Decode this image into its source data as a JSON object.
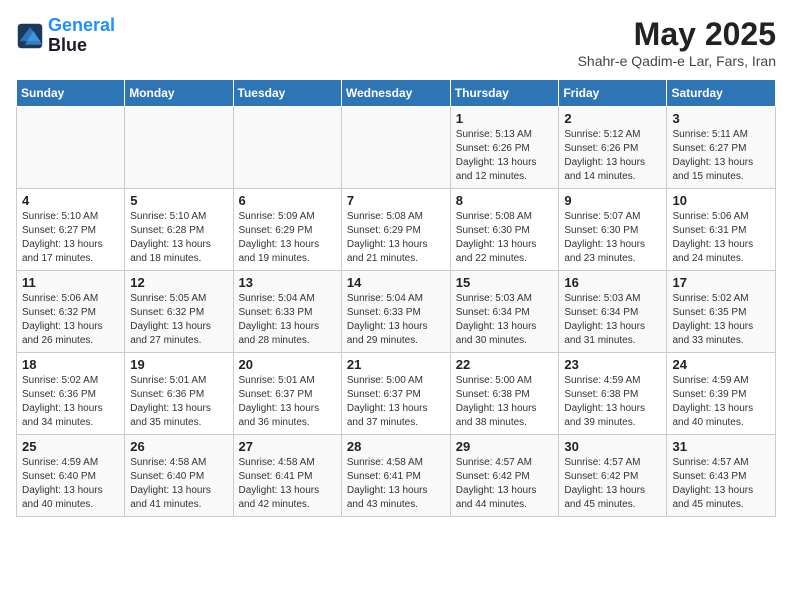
{
  "logo": {
    "line1": "General",
    "line2": "Blue"
  },
  "title": "May 2025",
  "location": "Shahr-e Qadim-e Lar, Fars, Iran",
  "weekdays": [
    "Sunday",
    "Monday",
    "Tuesday",
    "Wednesday",
    "Thursday",
    "Friday",
    "Saturday"
  ],
  "weeks": [
    [
      {
        "day": "",
        "info": ""
      },
      {
        "day": "",
        "info": ""
      },
      {
        "day": "",
        "info": ""
      },
      {
        "day": "",
        "info": ""
      },
      {
        "day": "1",
        "info": "Sunrise: 5:13 AM\nSunset: 6:26 PM\nDaylight: 13 hours\nand 12 minutes."
      },
      {
        "day": "2",
        "info": "Sunrise: 5:12 AM\nSunset: 6:26 PM\nDaylight: 13 hours\nand 14 minutes."
      },
      {
        "day": "3",
        "info": "Sunrise: 5:11 AM\nSunset: 6:27 PM\nDaylight: 13 hours\nand 15 minutes."
      }
    ],
    [
      {
        "day": "4",
        "info": "Sunrise: 5:10 AM\nSunset: 6:27 PM\nDaylight: 13 hours\nand 17 minutes."
      },
      {
        "day": "5",
        "info": "Sunrise: 5:10 AM\nSunset: 6:28 PM\nDaylight: 13 hours\nand 18 minutes."
      },
      {
        "day": "6",
        "info": "Sunrise: 5:09 AM\nSunset: 6:29 PM\nDaylight: 13 hours\nand 19 minutes."
      },
      {
        "day": "7",
        "info": "Sunrise: 5:08 AM\nSunset: 6:29 PM\nDaylight: 13 hours\nand 21 minutes."
      },
      {
        "day": "8",
        "info": "Sunrise: 5:08 AM\nSunset: 6:30 PM\nDaylight: 13 hours\nand 22 minutes."
      },
      {
        "day": "9",
        "info": "Sunrise: 5:07 AM\nSunset: 6:30 PM\nDaylight: 13 hours\nand 23 minutes."
      },
      {
        "day": "10",
        "info": "Sunrise: 5:06 AM\nSunset: 6:31 PM\nDaylight: 13 hours\nand 24 minutes."
      }
    ],
    [
      {
        "day": "11",
        "info": "Sunrise: 5:06 AM\nSunset: 6:32 PM\nDaylight: 13 hours\nand 26 minutes."
      },
      {
        "day": "12",
        "info": "Sunrise: 5:05 AM\nSunset: 6:32 PM\nDaylight: 13 hours\nand 27 minutes."
      },
      {
        "day": "13",
        "info": "Sunrise: 5:04 AM\nSunset: 6:33 PM\nDaylight: 13 hours\nand 28 minutes."
      },
      {
        "day": "14",
        "info": "Sunrise: 5:04 AM\nSunset: 6:33 PM\nDaylight: 13 hours\nand 29 minutes."
      },
      {
        "day": "15",
        "info": "Sunrise: 5:03 AM\nSunset: 6:34 PM\nDaylight: 13 hours\nand 30 minutes."
      },
      {
        "day": "16",
        "info": "Sunrise: 5:03 AM\nSunset: 6:34 PM\nDaylight: 13 hours\nand 31 minutes."
      },
      {
        "day": "17",
        "info": "Sunrise: 5:02 AM\nSunset: 6:35 PM\nDaylight: 13 hours\nand 33 minutes."
      }
    ],
    [
      {
        "day": "18",
        "info": "Sunrise: 5:02 AM\nSunset: 6:36 PM\nDaylight: 13 hours\nand 34 minutes."
      },
      {
        "day": "19",
        "info": "Sunrise: 5:01 AM\nSunset: 6:36 PM\nDaylight: 13 hours\nand 35 minutes."
      },
      {
        "day": "20",
        "info": "Sunrise: 5:01 AM\nSunset: 6:37 PM\nDaylight: 13 hours\nand 36 minutes."
      },
      {
        "day": "21",
        "info": "Sunrise: 5:00 AM\nSunset: 6:37 PM\nDaylight: 13 hours\nand 37 minutes."
      },
      {
        "day": "22",
        "info": "Sunrise: 5:00 AM\nSunset: 6:38 PM\nDaylight: 13 hours\nand 38 minutes."
      },
      {
        "day": "23",
        "info": "Sunrise: 4:59 AM\nSunset: 6:38 PM\nDaylight: 13 hours\nand 39 minutes."
      },
      {
        "day": "24",
        "info": "Sunrise: 4:59 AM\nSunset: 6:39 PM\nDaylight: 13 hours\nand 40 minutes."
      }
    ],
    [
      {
        "day": "25",
        "info": "Sunrise: 4:59 AM\nSunset: 6:40 PM\nDaylight: 13 hours\nand 40 minutes."
      },
      {
        "day": "26",
        "info": "Sunrise: 4:58 AM\nSunset: 6:40 PM\nDaylight: 13 hours\nand 41 minutes."
      },
      {
        "day": "27",
        "info": "Sunrise: 4:58 AM\nSunset: 6:41 PM\nDaylight: 13 hours\nand 42 minutes."
      },
      {
        "day": "28",
        "info": "Sunrise: 4:58 AM\nSunset: 6:41 PM\nDaylight: 13 hours\nand 43 minutes."
      },
      {
        "day": "29",
        "info": "Sunrise: 4:57 AM\nSunset: 6:42 PM\nDaylight: 13 hours\nand 44 minutes."
      },
      {
        "day": "30",
        "info": "Sunrise: 4:57 AM\nSunset: 6:42 PM\nDaylight: 13 hours\nand 45 minutes."
      },
      {
        "day": "31",
        "info": "Sunrise: 4:57 AM\nSunset: 6:43 PM\nDaylight: 13 hours\nand 45 minutes."
      }
    ]
  ]
}
